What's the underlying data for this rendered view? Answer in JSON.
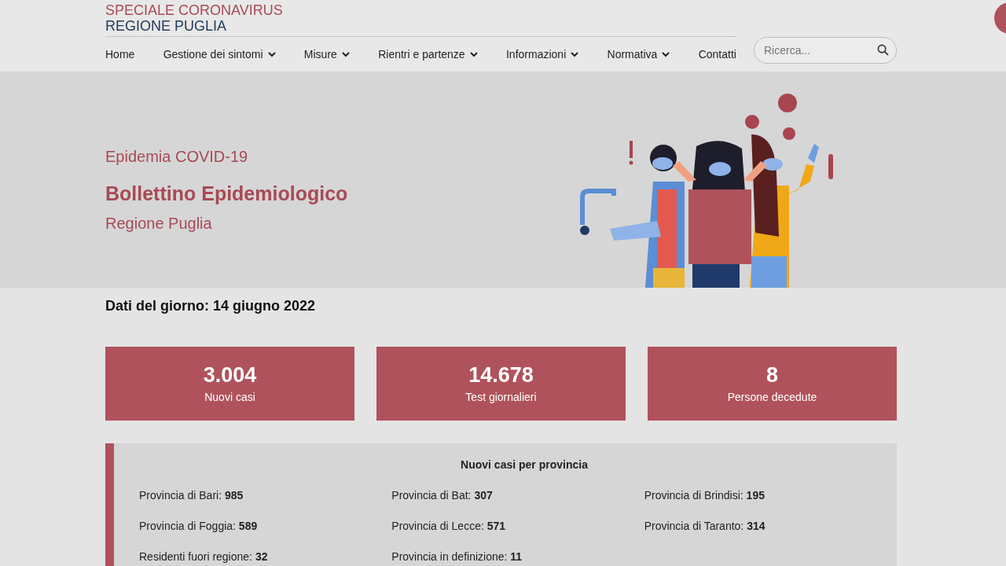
{
  "header": {
    "title_line_1": "SPECIALE CORONAVIRUS",
    "title_line_2": "REGIONE PUGLIA"
  },
  "nav": [
    {
      "label": "Home",
      "has_dropdown": false
    },
    {
      "label": "Gestione dei sintomi",
      "has_dropdown": true
    },
    {
      "label": "Misure",
      "has_dropdown": true
    },
    {
      "label": "Rientri e partenze",
      "has_dropdown": true
    },
    {
      "label": "Informazioni",
      "has_dropdown": true
    },
    {
      "label": "Normativa",
      "has_dropdown": true
    },
    {
      "label": "Contatti",
      "has_dropdown": false
    }
  ],
  "search": {
    "placeholder": "Ricerca..."
  },
  "hero": {
    "kicker": "Epidemia COVID-19",
    "title": "Bollettino Epidemiologico",
    "subtitle": "Regione Puglia"
  },
  "date_heading": "Dati del giorno: 14 giugno 2022",
  "stats": [
    {
      "value": "3.004",
      "label": "Nuovi casi"
    },
    {
      "value": "14.678",
      "label": "Test giornalieri"
    },
    {
      "value": "8",
      "label": "Persone decedute"
    }
  ],
  "provinces": {
    "title": "Nuovi casi per provincia",
    "items": [
      {
        "label": "Provincia di Bari:",
        "value": "985"
      },
      {
        "label": "Provincia di Bat:",
        "value": "307"
      },
      {
        "label": "Provincia di Brindisi:",
        "value": "195"
      },
      {
        "label": "Provincia di Foggia:",
        "value": "589"
      },
      {
        "label": "Provincia di Lecce:",
        "value": "571"
      },
      {
        "label": "Provincia di Taranto:",
        "value": "314"
      },
      {
        "label": "Residenti fuori regione:",
        "value": "32"
      },
      {
        "label": "Provincia in definizione:",
        "value": "11"
      }
    ]
  }
}
